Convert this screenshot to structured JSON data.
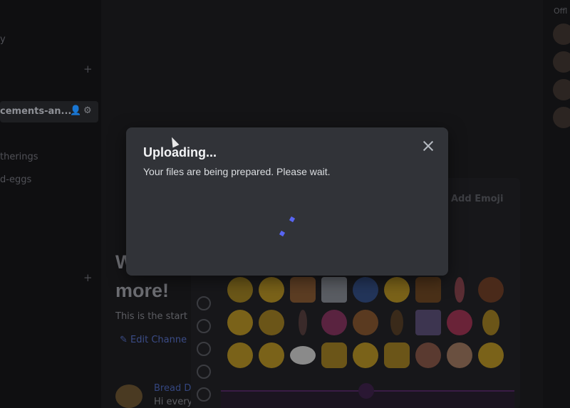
{
  "sidebar": {
    "items": [
      {
        "label": "y"
      },
      {
        "label": "cements-an..."
      },
      {
        "label": "therings"
      },
      {
        "label": "d-eggs"
      }
    ]
  },
  "main": {
    "welcome_line1": "W",
    "welcome_line2": "more!",
    "welcome_sub": "This is the start",
    "edit_channel": "Edit Channe",
    "message": {
      "author": "Bread D",
      "text": "Hi every"
    },
    "emoji_picker": {
      "add_emoji_label": "Add Emoji"
    }
  },
  "members": {
    "header": "Offl"
  },
  "modal": {
    "title": "Uploading...",
    "description": "Your files are being prepared. Please wait."
  },
  "colors": {
    "modal_bg": "#313338",
    "accent": "#5865f2",
    "backdrop": "#0e0e10"
  }
}
